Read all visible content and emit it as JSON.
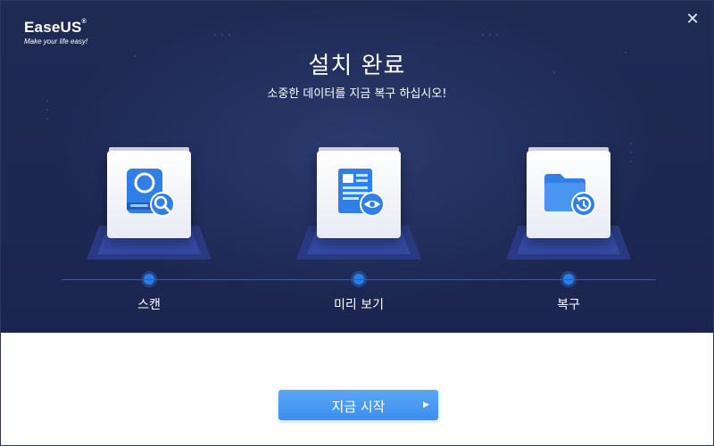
{
  "brand": {
    "name": "EaseUS",
    "registered": "®",
    "tagline": "Make your life easy!"
  },
  "header": {
    "title": "설치 완료",
    "subtitle": "소중한 데이터를 지금 복구 하십시오!"
  },
  "steps": [
    {
      "label": "스캔",
      "icon": "drive-search-icon"
    },
    {
      "label": "미리 보기",
      "icon": "document-preview-icon"
    },
    {
      "label": "복구",
      "icon": "folder-restore-icon"
    }
  ],
  "window": {
    "close_glyph": "✕"
  },
  "action": {
    "start_label": "지금 시작",
    "arrow_glyph": "▶"
  },
  "colors": {
    "hero_bg": "#1f2a53",
    "accent": "#2b7de9",
    "button": "#4a9af3"
  }
}
